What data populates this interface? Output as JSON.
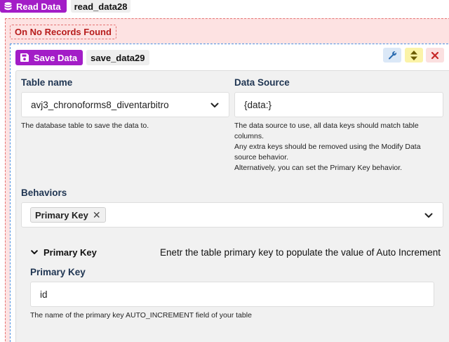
{
  "read_block": {
    "label": "Read Data",
    "name": "read_data28"
  },
  "event_block": {
    "label": "On No Records Found"
  },
  "save_block": {
    "label": "Save Data",
    "name": "save_data29"
  },
  "toolbar": {
    "icons": [
      "wrench-icon",
      "sort-icon",
      "close-icon"
    ]
  },
  "form": {
    "table_name": {
      "label": "Table name",
      "value": "avj3_chronoforms8_diventarbitro",
      "help": "The database table to save the data to."
    },
    "data_source": {
      "label": "Data Source",
      "value": "{data:}",
      "help": [
        "The data source to use, all data keys should match table",
        "columns.",
        "Any extra keys should be removed using the Modify Data",
        "source behavior.",
        "Alternatively, you can set the Primary Key behavior."
      ]
    },
    "behaviors": {
      "label": "Behaviors",
      "selected": [
        "Primary Key"
      ]
    },
    "primary_key_section": {
      "title": "Primary Key",
      "description": "Enetr the table primary key to populate the value of Auto Increment",
      "field_label": "Primary Key",
      "value": "id",
      "help": "The name of the primary key AUTO_INCREMENT field of your table"
    }
  },
  "colors": {
    "purple": "#a31dc7",
    "event_bg": "#fde2e2",
    "event_border": "#e57373",
    "action_border": "#4a90e2",
    "panel_bg": "#f1f1f1",
    "label": "#1f3552"
  }
}
